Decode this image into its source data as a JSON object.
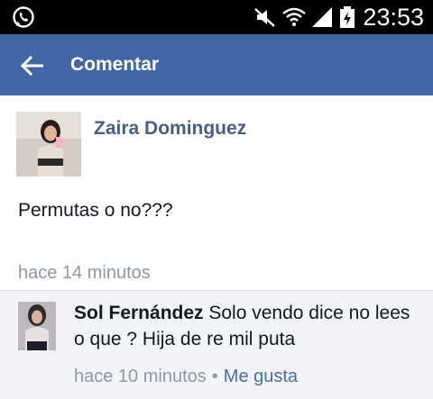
{
  "status_bar": {
    "time": "23:53",
    "icons": [
      "whatsapp-icon",
      "mute-icon",
      "wifi-icon",
      "signal-icon",
      "battery-icon"
    ]
  },
  "app_bar": {
    "title": "Comentar",
    "back_icon": "arrow-left-icon",
    "color": "#4267a6"
  },
  "post": {
    "author": "Zaira Dominguez",
    "text": "Permutas o no???",
    "time": "hace 14 minutos"
  },
  "comments": [
    {
      "author": "Sol Fernández",
      "text": "Solo vendo dice no lees o que ? Hija de re mil puta",
      "time": "hace 10 minutos",
      "separator": "•",
      "like_label": "Me gusta"
    }
  ],
  "colors": {
    "link": "#4b6ea8",
    "author": "#4b5f85",
    "meta": "#9197a3",
    "comment_bg": "#f3f4f7"
  }
}
